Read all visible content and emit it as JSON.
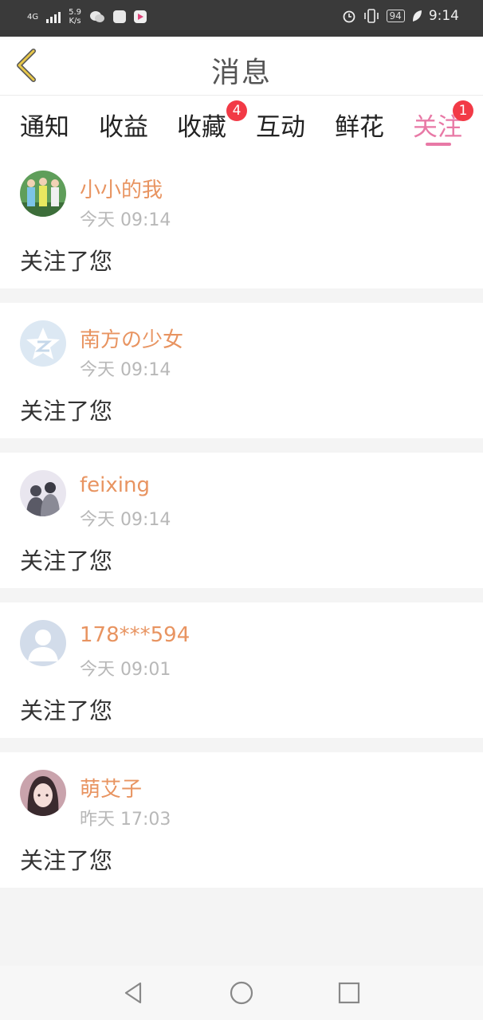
{
  "status_bar": {
    "network_type": "4G",
    "speed_value": "5.9",
    "speed_unit": "K/s",
    "battery": "94",
    "time": "9:14",
    "icons": [
      "signal-icon",
      "wechat-icon",
      "app-icon",
      "video-icon",
      "alarm-icon",
      "vibrate-icon",
      "battery-icon",
      "leaf-icon"
    ]
  },
  "header": {
    "title": "消息",
    "back_icon": "chevron-left-icon"
  },
  "tabs": [
    {
      "label": "通知",
      "badge": "",
      "active": false
    },
    {
      "label": "收益",
      "badge": "",
      "active": false
    },
    {
      "label": "收藏",
      "badge": "4",
      "active": false
    },
    {
      "label": "互动",
      "badge": "",
      "active": false
    },
    {
      "label": "鲜花",
      "badge": "",
      "active": false
    },
    {
      "label": "关注",
      "badge": "1",
      "active": true
    }
  ],
  "messages": [
    {
      "name": "小小的我",
      "time": "今天 09:14",
      "text": "关注了您",
      "avatar": "group-photo-avatar"
    },
    {
      "name": "南方の少女",
      "time": "今天 09:14",
      "text": "关注了您",
      "avatar": "qzone-star-avatar"
    },
    {
      "name": "feixing",
      "time": "今天 09:14",
      "text": "关注了您",
      "avatar": "couple-photo-avatar"
    },
    {
      "name": "178***594",
      "time": "今天 09:01",
      "text": "关注了您",
      "avatar": "default-user-avatar"
    },
    {
      "name": "萌艾子",
      "time": "昨天 17:03",
      "text": "关注了您",
      "avatar": "girl-photo-avatar"
    }
  ],
  "colors": {
    "accent": "#e879a6",
    "name": "#e89461",
    "badge": "#f23a46",
    "back_arrow": "#e8c84a"
  },
  "nav_bar": [
    "back-triangle-icon",
    "home-circle-icon",
    "recents-square-icon"
  ]
}
